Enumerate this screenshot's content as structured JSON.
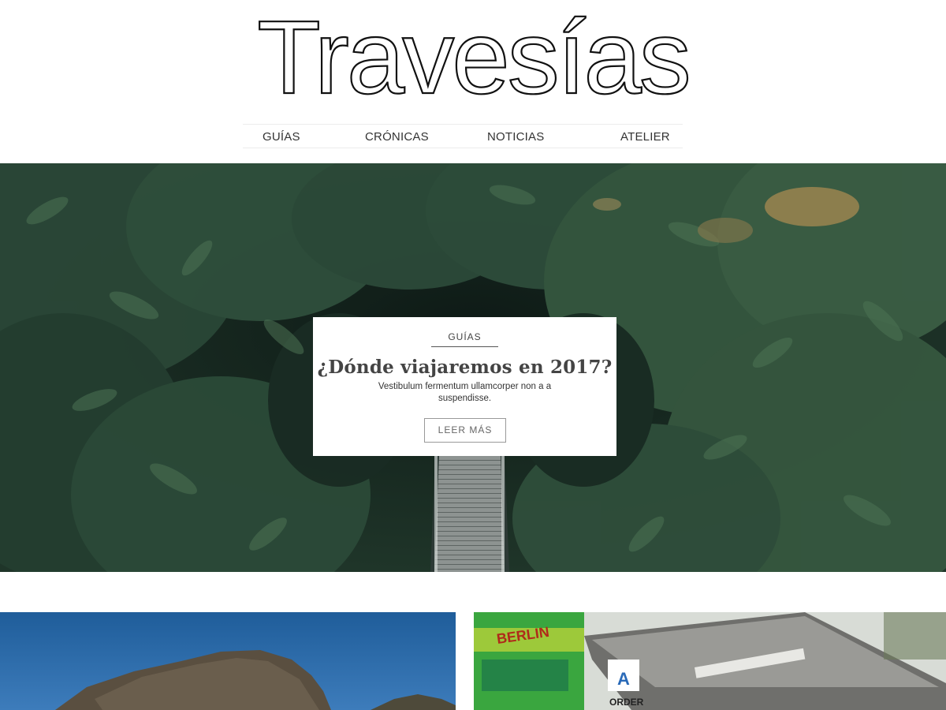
{
  "header": {
    "logo_text": "Travesías"
  },
  "nav": {
    "items": [
      {
        "label": "GUÍAS"
      },
      {
        "label": "CRÓNICAS"
      },
      {
        "label": "NOTICIAS"
      },
      {
        "label": "ATELIER"
      }
    ]
  },
  "hero": {
    "category": "GUÍAS",
    "title": "¿Dónde viajaremos en 2017?",
    "description": "Vestibulum fermentum ullamcorper non a a suspendisse.",
    "button_label": "LEER MÁS"
  },
  "thumbnails": [
    {
      "sign_top": "BERLIN",
      "sign_badge": "A",
      "sign_order": "ORDER"
    }
  ],
  "colors": {
    "forest": "#1e3328",
    "text": "#333333"
  }
}
